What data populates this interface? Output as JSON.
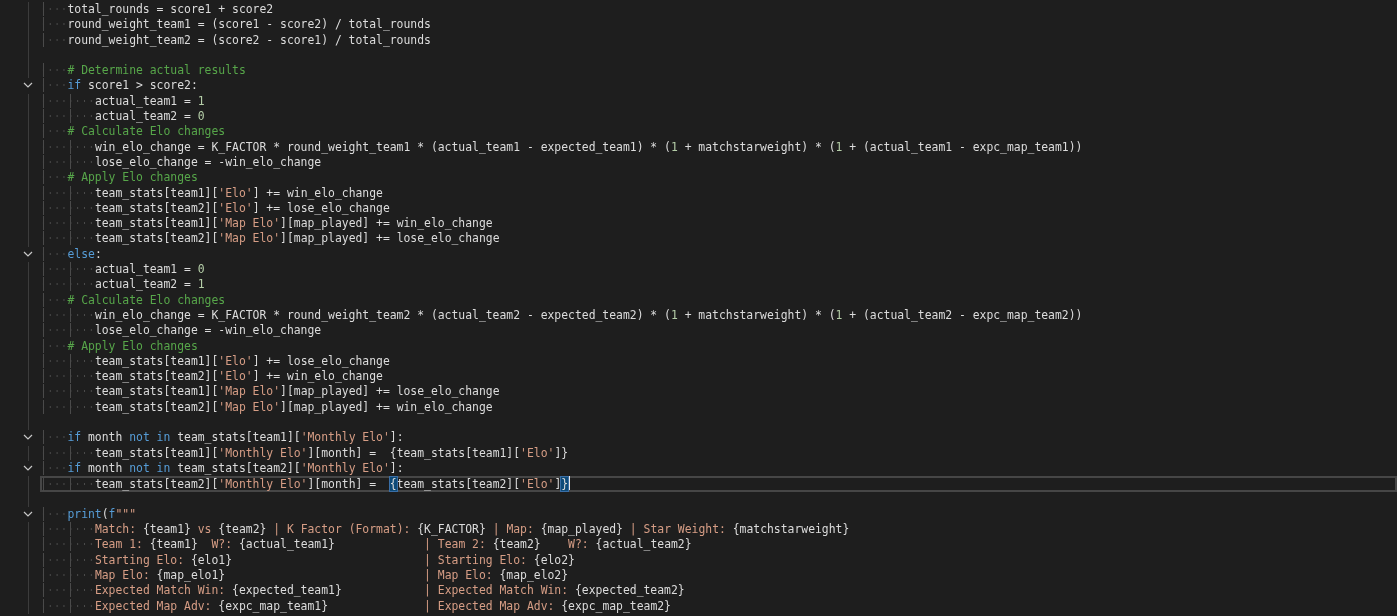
{
  "editor": {
    "lines": [
      {
        "fold": false,
        "current": false,
        "tokens": [
          {
            "kind": "plain",
            "text": "    total_rounds = score1 + score2"
          }
        ]
      },
      {
        "fold": false,
        "current": false,
        "tokens": [
          {
            "kind": "plain",
            "text": "    round_weight_team1 = (score1 - score2) / total_rounds"
          }
        ]
      },
      {
        "fold": false,
        "current": false,
        "tokens": [
          {
            "kind": "plain",
            "text": "    round_weight_team2 = (score2 - score1) / total_rounds"
          }
        ]
      },
      {
        "fold": false,
        "current": false
      },
      {
        "fold": false,
        "current": false,
        "tokens": [
          {
            "kind": "comment",
            "text": "    # Determine actual results"
          }
        ]
      },
      {
        "fold": true,
        "current": false,
        "tokens": [
          {
            "kind": "keyword",
            "text": "    if"
          },
          {
            "kind": "plain",
            "text": " score1 > score2:"
          }
        ]
      },
      {
        "fold": false,
        "current": false,
        "tokens": [
          {
            "kind": "plain",
            "text": "        actual_team1 = "
          },
          {
            "kind": "number",
            "text": "1"
          }
        ]
      },
      {
        "fold": false,
        "current": false,
        "tokens": [
          {
            "kind": "plain",
            "text": "        actual_team2 = "
          },
          {
            "kind": "number",
            "text": "0"
          }
        ]
      },
      {
        "fold": false,
        "current": false,
        "tokens": [
          {
            "kind": "comment",
            "text": "    # Calculate Elo changes"
          }
        ]
      },
      {
        "fold": false,
        "current": false,
        "tokens": [
          {
            "kind": "plain",
            "text": "        win_elo_change = K_FACTOR * round_weight_team1 * (actual_team1 - expected_team1) * ("
          },
          {
            "kind": "number",
            "text": "1"
          },
          {
            "kind": "plain",
            "text": " + matchstarweight) * ("
          },
          {
            "kind": "number",
            "text": "1"
          },
          {
            "kind": "plain",
            "text": " + (actual_team1 - expc_map_team1))"
          }
        ]
      },
      {
        "fold": false,
        "current": false,
        "tokens": [
          {
            "kind": "plain",
            "text": "        lose_elo_change = -win_elo_change"
          }
        ]
      },
      {
        "fold": false,
        "current": false,
        "tokens": [
          {
            "kind": "comment",
            "text": "    # Apply Elo changes"
          }
        ]
      },
      {
        "fold": false,
        "current": false,
        "tokens": [
          {
            "kind": "plain",
            "text": "        team_stats[team1]["
          },
          {
            "kind": "string",
            "text": "'Elo'"
          },
          {
            "kind": "plain",
            "text": "] += win_elo_change"
          }
        ]
      },
      {
        "fold": false,
        "current": false,
        "tokens": [
          {
            "kind": "plain",
            "text": "        team_stats[team2]["
          },
          {
            "kind": "string",
            "text": "'Elo'"
          },
          {
            "kind": "plain",
            "text": "] += lose_elo_change"
          }
        ]
      },
      {
        "fold": false,
        "current": false,
        "tokens": [
          {
            "kind": "plain",
            "text": "        team_stats[team1]["
          },
          {
            "kind": "string",
            "text": "'Map Elo'"
          },
          {
            "kind": "plain",
            "text": "][map_played] += win_elo_change"
          }
        ]
      },
      {
        "fold": false,
        "current": false,
        "tokens": [
          {
            "kind": "plain",
            "text": "        team_stats[team2]["
          },
          {
            "kind": "string",
            "text": "'Map Elo'"
          },
          {
            "kind": "plain",
            "text": "][map_played] += lose_elo_change"
          }
        ]
      },
      {
        "fold": true,
        "current": false,
        "tokens": [
          {
            "kind": "keyword",
            "text": "    else"
          },
          {
            "kind": "plain",
            "text": ":"
          }
        ]
      },
      {
        "fold": false,
        "current": false,
        "tokens": [
          {
            "kind": "plain",
            "text": "        actual_team1 = "
          },
          {
            "kind": "number",
            "text": "0"
          }
        ]
      },
      {
        "fold": false,
        "current": false,
        "tokens": [
          {
            "kind": "plain",
            "text": "        actual_team2 = "
          },
          {
            "kind": "number",
            "text": "1"
          }
        ]
      },
      {
        "fold": false,
        "current": false,
        "tokens": [
          {
            "kind": "comment",
            "text": "    # Calculate Elo changes"
          }
        ]
      },
      {
        "fold": false,
        "current": false,
        "tokens": [
          {
            "kind": "plain",
            "text": "        win_elo_change = K_FACTOR * round_weight_team2 * (actual_team2 - expected_team2) * ("
          },
          {
            "kind": "number",
            "text": "1"
          },
          {
            "kind": "plain",
            "text": " + matchstarweight) * ("
          },
          {
            "kind": "number",
            "text": "1"
          },
          {
            "kind": "plain",
            "text": " + (actual_team2 - expc_map_team2))"
          }
        ]
      },
      {
        "fold": false,
        "current": false,
        "tokens": [
          {
            "kind": "plain",
            "text": "        lose_elo_change = -win_elo_change"
          }
        ]
      },
      {
        "fold": false,
        "current": false,
        "tokens": [
          {
            "kind": "comment",
            "text": "    # Apply Elo changes"
          }
        ]
      },
      {
        "fold": false,
        "current": false,
        "tokens": [
          {
            "kind": "plain",
            "text": "        team_stats[team1]["
          },
          {
            "kind": "string",
            "text": "'Elo'"
          },
          {
            "kind": "plain",
            "text": "] += lose_elo_change"
          }
        ]
      },
      {
        "fold": false,
        "current": false,
        "tokens": [
          {
            "kind": "plain",
            "text": "        team_stats[team2]["
          },
          {
            "kind": "string",
            "text": "'Elo'"
          },
          {
            "kind": "plain",
            "text": "] += win_elo_change"
          }
        ]
      },
      {
        "fold": false,
        "current": false,
        "tokens": [
          {
            "kind": "plain",
            "text": "        team_stats[team1]["
          },
          {
            "kind": "string",
            "text": "'Map Elo'"
          },
          {
            "kind": "plain",
            "text": "][map_played] += lose_elo_change"
          }
        ]
      },
      {
        "fold": false,
        "current": false,
        "tokens": [
          {
            "kind": "plain",
            "text": "        team_stats[team2]["
          },
          {
            "kind": "string",
            "text": "'Map Elo'"
          },
          {
            "kind": "plain",
            "text": "][map_played] += win_elo_change"
          }
        ]
      },
      {
        "fold": false,
        "current": false
      },
      {
        "fold": true,
        "current": false,
        "tokens": [
          {
            "kind": "keyword",
            "text": "    if"
          },
          {
            "kind": "plain",
            "text": " month "
          },
          {
            "kind": "keyword",
            "text": "not in"
          },
          {
            "kind": "plain",
            "text": " team_stats[team1]["
          },
          {
            "kind": "string",
            "text": "'Monthly Elo'"
          },
          {
            "kind": "plain",
            "text": "]:"
          }
        ]
      },
      {
        "fold": false,
        "current": false,
        "tokens": [
          {
            "kind": "plain",
            "text": "        team_stats[team1]["
          },
          {
            "kind": "string",
            "text": "'Monthly Elo'"
          },
          {
            "kind": "plain",
            "text": "][month] =  {team_stats[team1]["
          },
          {
            "kind": "string",
            "text": "'Elo'"
          },
          {
            "kind": "plain",
            "text": "]}"
          }
        ]
      },
      {
        "fold": true,
        "current": false,
        "tokens": [
          {
            "kind": "keyword",
            "text": "    if"
          },
          {
            "kind": "plain",
            "text": " month "
          },
          {
            "kind": "keyword",
            "text": "not in"
          },
          {
            "kind": "plain",
            "text": " team_stats[team2]["
          },
          {
            "kind": "string",
            "text": "'Monthly Elo'"
          },
          {
            "kind": "plain",
            "text": "]:"
          }
        ]
      },
      {
        "fold": false,
        "current": true,
        "tokens": [
          {
            "kind": "plain",
            "text": "        team_stats[team2]["
          },
          {
            "kind": "string",
            "text": "'Monthly Elo'"
          },
          {
            "kind": "plain",
            "text": "][month] =  "
          },
          {
            "kind": "match",
            "text": "{"
          },
          {
            "kind": "plain",
            "text": "team_stats[team2]["
          },
          {
            "kind": "string",
            "text": "'Elo'"
          },
          {
            "kind": "plain",
            "text": "]"
          },
          {
            "kind": "match",
            "text": "}"
          }
        ]
      },
      {
        "fold": false,
        "current": false
      },
      {
        "fold": true,
        "current": false,
        "tokens": [
          {
            "kind": "keyword",
            "text": "    print"
          },
          {
            "kind": "plain",
            "text": "("
          },
          {
            "kind": "keyword",
            "text": "f"
          },
          {
            "kind": "string",
            "text": "\"\"\""
          }
        ]
      },
      {
        "fold": false,
        "current": false,
        "tokens": [
          {
            "kind": "string",
            "text": "        Match: "
          },
          {
            "kind": "plain",
            "text": "{team1}"
          },
          {
            "kind": "string",
            "text": " vs "
          },
          {
            "kind": "plain",
            "text": "{team2}"
          },
          {
            "kind": "string",
            "text": " | K Factor (Format): "
          },
          {
            "kind": "plain",
            "text": "{K_FACTOR}"
          },
          {
            "kind": "string",
            "text": " | Map: "
          },
          {
            "kind": "plain",
            "text": "{map_played}"
          },
          {
            "kind": "string",
            "text": " | Star Weight: "
          },
          {
            "kind": "plain",
            "text": "{matchstarweight}"
          }
        ]
      },
      {
        "fold": false,
        "current": false,
        "tokens": [
          {
            "kind": "string",
            "text": "        Team 1: "
          },
          {
            "kind": "plain",
            "text": "{team1}"
          },
          {
            "kind": "string",
            "text": "  W?: "
          },
          {
            "kind": "plain",
            "text": "{actual_team1}"
          },
          {
            "kind": "string",
            "text": "             | Team 2: "
          },
          {
            "kind": "plain",
            "text": "{team2}"
          },
          {
            "kind": "string",
            "text": "    W?: "
          },
          {
            "kind": "plain",
            "text": "{actual_team2}"
          }
        ]
      },
      {
        "fold": false,
        "current": false,
        "tokens": [
          {
            "kind": "string",
            "text": "        Starting Elo: "
          },
          {
            "kind": "plain",
            "text": "{elo1}"
          },
          {
            "kind": "string",
            "text": "                            | Starting Elo: "
          },
          {
            "kind": "plain",
            "text": "{elo2}"
          }
        ]
      },
      {
        "fold": false,
        "current": false,
        "tokens": [
          {
            "kind": "string",
            "text": "        Map Elo: "
          },
          {
            "kind": "plain",
            "text": "{map_elo1}"
          },
          {
            "kind": "string",
            "text": "                             | Map Elo: "
          },
          {
            "kind": "plain",
            "text": "{map_elo2}"
          }
        ]
      },
      {
        "fold": false,
        "current": false,
        "tokens": [
          {
            "kind": "string",
            "text": "        Expected Match Win: "
          },
          {
            "kind": "plain",
            "text": "{expected_team1}"
          },
          {
            "kind": "string",
            "text": "            | Expected Match Win: "
          },
          {
            "kind": "plain",
            "text": "{expected_team2}"
          }
        ]
      },
      {
        "fold": false,
        "current": false,
        "tokens": [
          {
            "kind": "string",
            "text": "        Expected Map Adv: "
          },
          {
            "kind": "plain",
            "text": "{expc_map_team1}"
          },
          {
            "kind": "string",
            "text": "              | Expected Map Adv: "
          },
          {
            "kind": "plain",
            "text": "{expc_map_team2}"
          }
        ]
      }
    ]
  }
}
